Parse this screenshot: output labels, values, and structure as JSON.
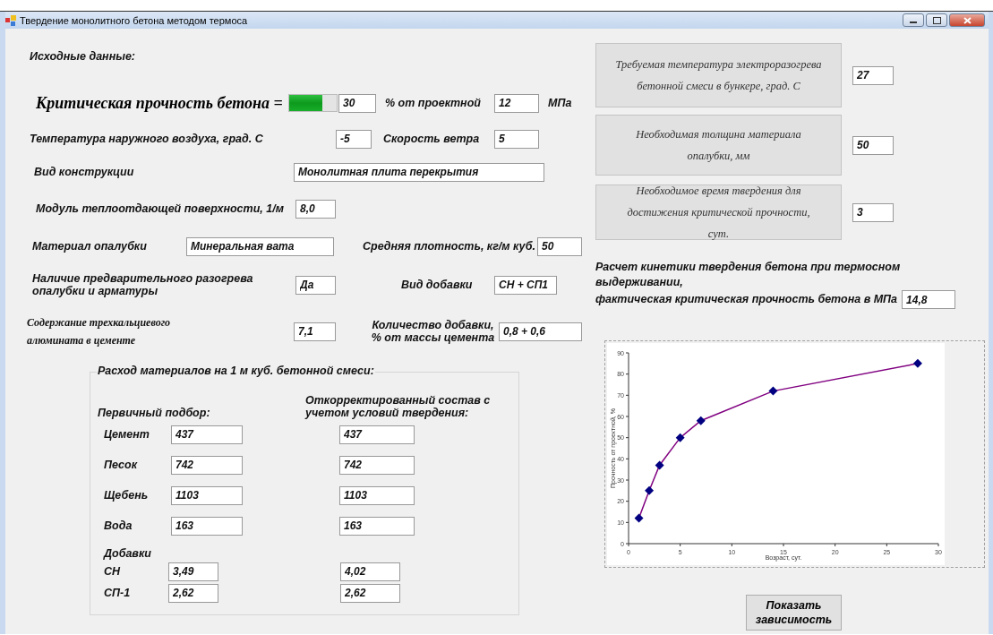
{
  "window": {
    "title": "Твердение монолитного бетона методом термоса"
  },
  "heading": "Исходные данные:",
  "critical": {
    "label": "Критическая прочность бетона =",
    "level": 0.7,
    "percent": "30",
    "percent_label": "% от проектной",
    "mpa": "12",
    "mpa_label": "МПа"
  },
  "rows": [
    [
      {
        "label": "Температура наружного воздуха, град. С",
        "value": "-5"
      },
      {
        "label": "Скорость ветра",
        "value": "5"
      }
    ],
    [
      {
        "label": "Вид конструкции",
        "value": "Монолитная плита перекрытия"
      }
    ],
    [
      {
        "label": "Модуль теплоотдающей поверхности, 1/м",
        "value": "8,0"
      }
    ],
    [
      {
        "label": "Материал опалубки",
        "value": "Минеральная вата"
      },
      {
        "label": "Средняя плотность, кг/м куб.",
        "value": "50"
      }
    ],
    [
      {
        "label": "Наличие предварительного разогрева опалубки и арматуры",
        "value": "Да"
      },
      {
        "label": "Вид добавки",
        "value": "СН + СП1"
      }
    ],
    [
      {
        "label": "Содержание  трехкальциевого алюмината в цементе",
        "value": "7,1"
      },
      {
        "label": "Количество добавки, % от массы цемента",
        "value": "0,8 + 0,6"
      }
    ]
  ],
  "materials": {
    "title": "Расход материалов на 1 м куб. бетонной смеси:",
    "primary_heading": "Первичный подбор:",
    "corrected_heading": "Откорректированный состав с учетом условий твердения:",
    "rows": [
      {
        "label": "Цемент",
        "primary": "437",
        "corrected": "437"
      },
      {
        "label": "Песок",
        "primary": "742",
        "corrected": "742"
      },
      {
        "label": "Щебень",
        "primary": "1103",
        "corrected": "1103"
      },
      {
        "label": "Вода",
        "primary": "163",
        "corrected": "163"
      }
    ],
    "additives_heading": "Добавки",
    "additives": [
      {
        "label": "СН",
        "primary": "3,49",
        "corrected": "4,02"
      },
      {
        "label": "СП-1",
        "primary": "2,62",
        "corrected": "2,62"
      }
    ]
  },
  "results": [
    {
      "label": "Требуемая температура электроразогрева бетонной смеси в бункере, град. С",
      "value": "27"
    },
    {
      "label": "Необходимая толщина  материала опалубки, мм",
      "value": "50"
    },
    {
      "label": "Необходимое время твердения для достижения критической прочности, сут.",
      "value": "3"
    }
  ],
  "kinetics": {
    "title": "Расчет кинетики твердения бетона при термосном выдерживании,",
    "label": "фактическая критическая прочность бетона в МПа",
    "value": "14,8",
    "chart_data": {
      "type": "line",
      "xlabel": "Возраст, сут.",
      "ylabel": "Прочность от проектной, %",
      "x": [
        1,
        2,
        3,
        5,
        7,
        14,
        28
      ],
      "series": [
        {
          "color": "#800080",
          "marker": "diamond",
          "values": [
            12,
            25,
            37,
            50,
            58,
            72,
            85
          ]
        }
      ],
      "xlim": [
        0,
        30
      ],
      "ylim": [
        0,
        90
      ],
      "xticks": [
        0,
        5,
        10,
        15,
        20,
        25,
        30
      ],
      "yticks": [
        0,
        10,
        20,
        30,
        40,
        50,
        60,
        70,
        80,
        90
      ]
    }
  },
  "show_button": "Показать зависимость"
}
